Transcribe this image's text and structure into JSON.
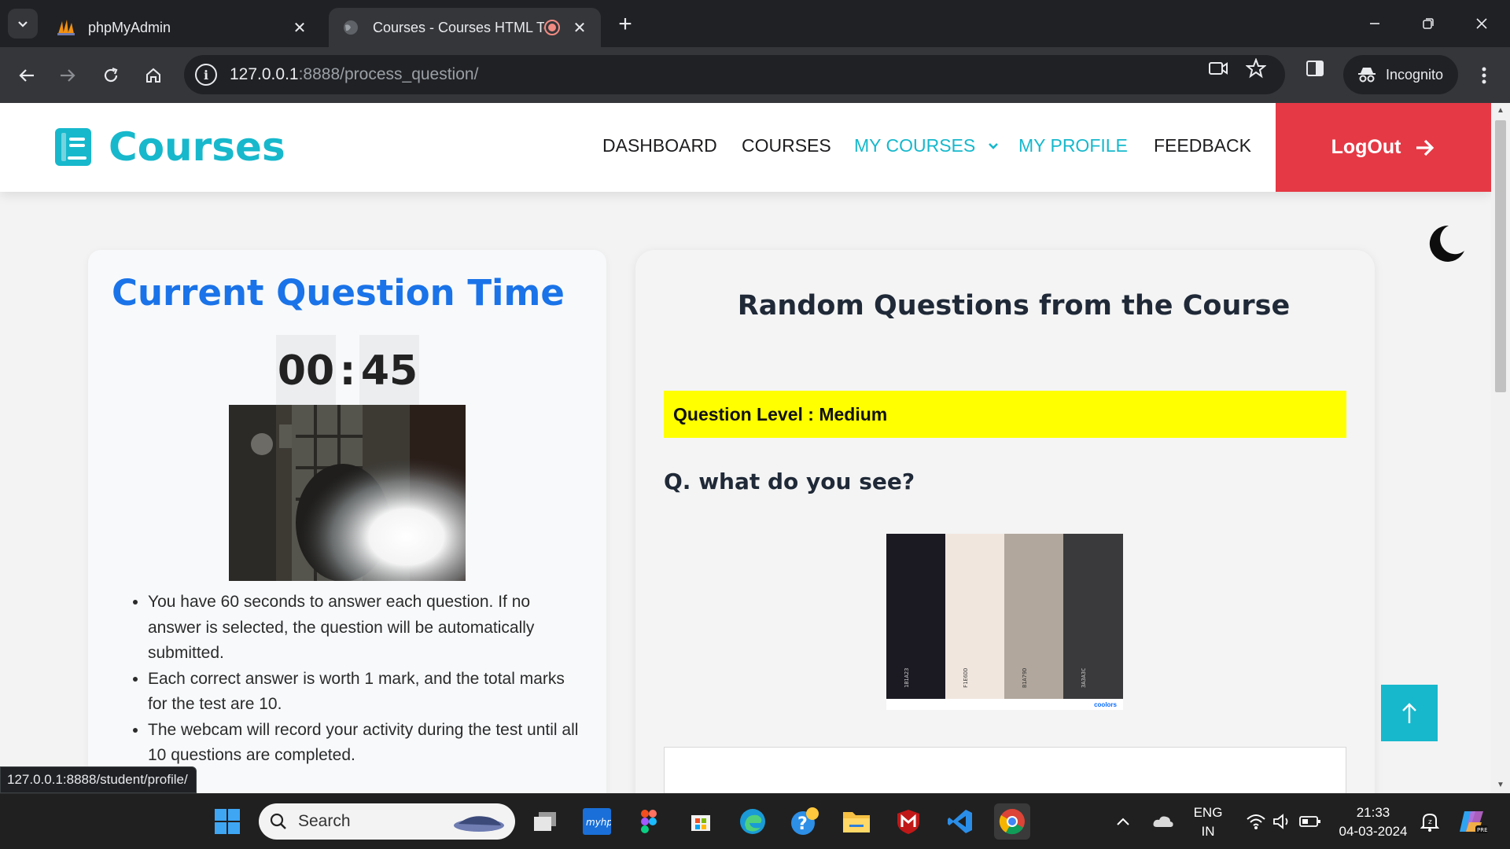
{
  "browser": {
    "tabs": [
      {
        "title": "phpMyAdmin",
        "active": false
      },
      {
        "title": "Courses - Courses HTML Te",
        "active": true
      }
    ],
    "url_host": "127.0.0.1",
    "url_rest": ":8888/process_question/",
    "profile_label": "Incognito",
    "status_url": "127.0.0.1:8888/student/profile/"
  },
  "site": {
    "brand": "Courses",
    "nav": [
      {
        "label": "DASHBOARD",
        "accent": false
      },
      {
        "label": "COURSES",
        "accent": false
      },
      {
        "label": "MY COURSES",
        "accent": true
      },
      {
        "label": "MY PROFILE",
        "accent": true
      },
      {
        "label": "FEEDBACK",
        "accent": false
      }
    ],
    "logout_label": "LogOut",
    "colors": {
      "accent": "#17b8cc",
      "logout": "#e53945",
      "highlight": "#ffff00",
      "title_blue": "#1a73e8"
    }
  },
  "timer_card": {
    "title": "Current Question Time",
    "minutes": "00",
    "separator": ":",
    "seconds": "45",
    "rules": [
      "You have 60 seconds to answer each question. If no answer is selected, the question will be automatically submitted.",
      "Each correct answer is worth 1 mark, and the total marks for the test are 10.",
      "The webcam will record your activity during the test until all 10 questions are completed."
    ]
  },
  "question_card": {
    "title": "Random Questions from the Course",
    "level_text": "Question Level : Medium",
    "question": "Q. what do you see?",
    "palette": {
      "swatches": [
        {
          "hex": "#1B1A23",
          "label": "1B1A23"
        },
        {
          "hex": "#F1E6DE",
          "label": "F1E6DD"
        },
        {
          "hex": "#B1A79D",
          "label": "B1A79D"
        },
        {
          "hex": "#3A3A3C",
          "label": "3A3A3C"
        }
      ],
      "brand": "coolors"
    }
  },
  "taskbar": {
    "search_placeholder": "Search",
    "lang_top": "ENG",
    "lang_bottom": "IN",
    "time": "21:33",
    "date": "04-03-2024"
  }
}
